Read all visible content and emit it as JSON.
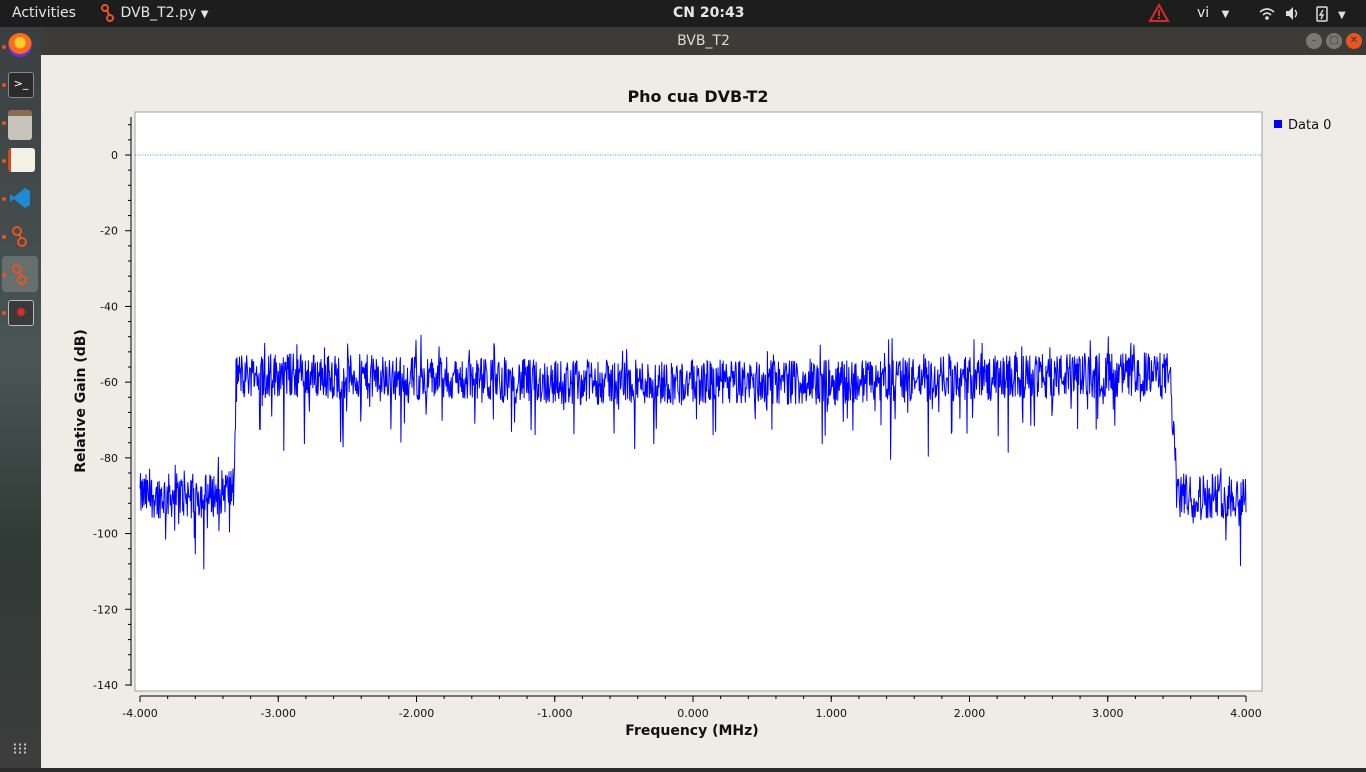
{
  "topbar": {
    "activities": "Activities",
    "app_name": "DVB_T2.py",
    "clock": "CN 20:43",
    "language": "vi"
  },
  "window": {
    "title": "BVB_T2"
  },
  "dock": {
    "apps": [
      "firefox-icon",
      "terminal-icon",
      "files-icon",
      "text-editor-icon",
      "vscode-icon",
      "gnuradio-icon",
      "gnuradio-active-icon",
      "screenshot-icon",
      "show-apps-icon"
    ]
  },
  "colors": {
    "trace": "#0000ff",
    "reference_line": "#3399cc",
    "accent": "#e95420",
    "warning": "#d42c2c"
  },
  "chart_data": {
    "type": "line",
    "title": "Pho cua DVB-T2",
    "xlabel": "Frequency (MHz)",
    "ylabel": "Relative Gain (dB)",
    "xlim": [
      -4.0,
      4.0
    ],
    "ylim": [
      -140,
      10
    ],
    "x_ticks": [
      "-4.000",
      "-3.000",
      "-2.000",
      "-1.000",
      "0.000",
      "1.000",
      "2.000",
      "3.000",
      "4.000"
    ],
    "y_ticks": [
      "0",
      "-20",
      "-40",
      "-60",
      "-80",
      "-100",
      "-120",
      "-140"
    ],
    "legend": "top-right",
    "series": [
      {
        "name": "Data 0",
        "x": [
          -4.0,
          -3.5,
          -3.32,
          -3.3,
          -3.0,
          -2.0,
          -1.0,
          0.0,
          1.0,
          2.0,
          3.0,
          3.45,
          3.48,
          3.5,
          4.0
        ],
        "y": [
          -90,
          -90,
          -88,
          -58,
          -58,
          -59,
          -60,
          -60,
          -60,
          -59,
          -58,
          -58,
          -75,
          -90,
          -90
        ]
      }
    ],
    "reference_line": {
      "y": 0
    }
  }
}
